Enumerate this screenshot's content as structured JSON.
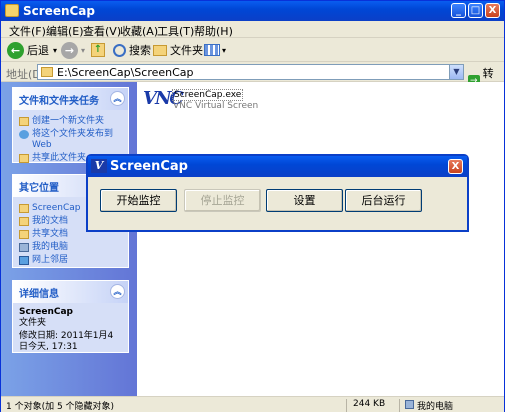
{
  "window": {
    "title": "ScreenCap",
    "min": "_",
    "max": "□",
    "close": "X"
  },
  "menu": [
    "文件(F)",
    "编辑(E)",
    "查看(V)",
    "收藏(A)",
    "工具(T)",
    "帮助(H)"
  ],
  "toolbar": {
    "back": "后退",
    "search": "搜索",
    "folders": "文件夹",
    "back_icon": "←",
    "forward_icon": "→",
    "up_icon": "↑",
    "drop": "▾"
  },
  "address": {
    "label": "地址(D)",
    "value": "E:\\ScreenCap\\ScreenCap",
    "go": "转到",
    "drop": "▼",
    "go_icon": "→"
  },
  "sidebar": {
    "tasks": {
      "title": "文件和文件夹任务",
      "items": [
        "创建一个新文件夹",
        "将这个文件夹发布到 Web",
        "共享此文件夹"
      ]
    },
    "places": {
      "title": "其它位置",
      "items": [
        "ScreenCap",
        "我的文档",
        "共享文档",
        "我的电脑",
        "网上邻居"
      ]
    },
    "details": {
      "title": "详细信息",
      "name": "ScreenCap",
      "type": "文件夹",
      "modified": "修改日期: 2011年1月4日今天, 17:31"
    },
    "collapse": "︽"
  },
  "file": {
    "name": "ScreenCap.exe",
    "description": "VNC Virtual Screen",
    "logo": "VNC"
  },
  "status": {
    "objects": "1 个对象(加 5 个隐藏对象)",
    "size": "244 KB",
    "location": "我的电脑"
  },
  "dialog": {
    "title": "ScreenCap",
    "icon": "V",
    "close": "X",
    "buttons": [
      "开始监控",
      "停止监控",
      "设置",
      "后台运行"
    ]
  },
  "colors": {
    "titlebar": "#0b3fc7",
    "sidebar": "#7ba2e7",
    "task_text": "#215dc6"
  }
}
